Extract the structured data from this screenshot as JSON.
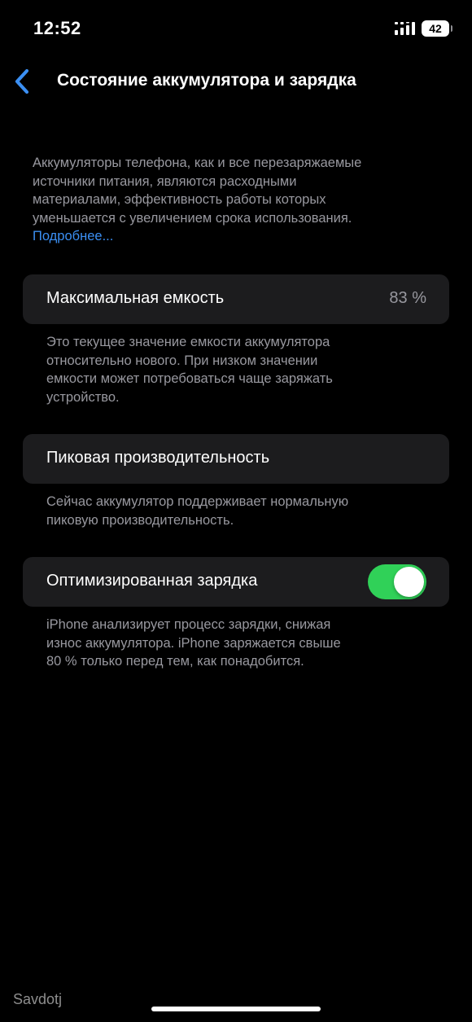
{
  "status_bar": {
    "time": "12:52",
    "battery_level": "42",
    "signal_icon": "signal-bars-icon"
  },
  "nav": {
    "back_icon": "chevron-left-icon",
    "title": "Состояние аккумулятора и зарядка"
  },
  "intro": {
    "lines": [
      "Аккумуляторы телефона, как и все перезаряжаемые",
      "источники питания, являются расходными",
      "материалами, эффективность работы которых",
      "уменьшается с увеличением срока использования."
    ],
    "link_label": "Подробнее..."
  },
  "max_capacity": {
    "label": "Максимальная емкость",
    "value": "83 %",
    "footnote_lines": [
      "Это текущее значение емкости аккумулятора",
      "относительно нового. При низком значении",
      "емкости может потребоваться чаще заряжать",
      "устройство."
    ]
  },
  "peak_performance": {
    "label": "Пиковая производительность",
    "footnote_lines": [
      "Сейчас аккумулятор поддерживает нормальную",
      "пиковую производительность."
    ]
  },
  "optimized_charging": {
    "label": "Оптимизированная зарядка",
    "toggle_on": true,
    "footnote_lines": [
      "iPhone анализирует процесс зарядки, снижая",
      "износ аккумулятора. iPhone заряжается свыше",
      "80 % только перед тем, как понадобится."
    ]
  },
  "colors": {
    "background": "#000000",
    "cell": "#1c1c1e",
    "secondary_text": "#98989f",
    "link": "#3b8ff3",
    "toggle_on": "#30d158"
  },
  "watermark": "Savdotj"
}
